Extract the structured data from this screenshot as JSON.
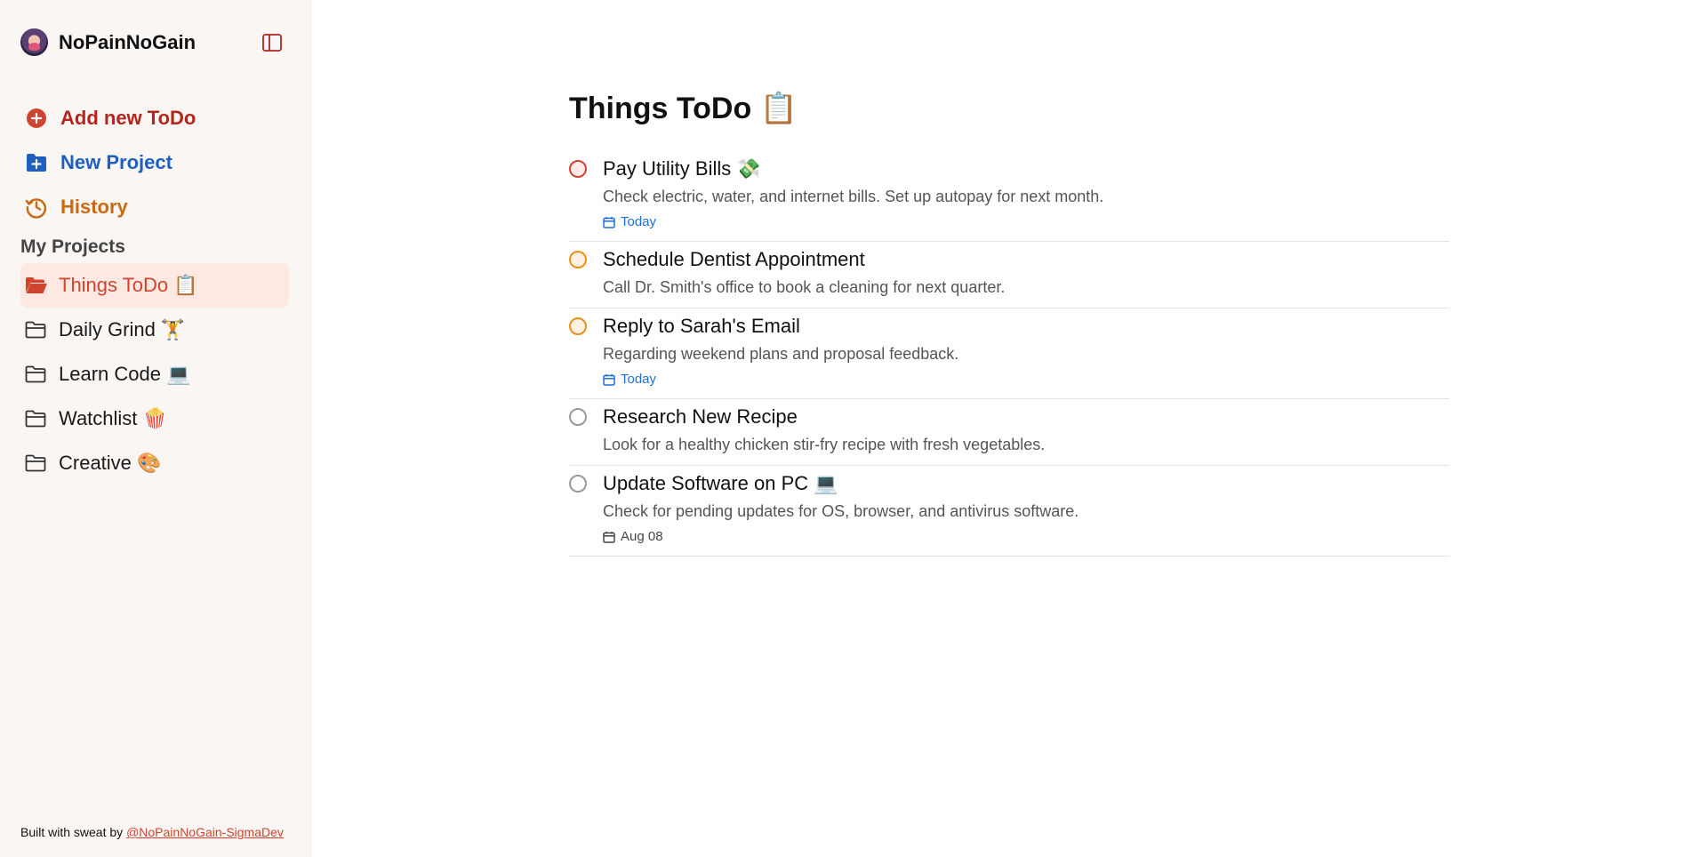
{
  "sidebar": {
    "brand": "NoPainNoGain",
    "actions": {
      "add_todo": "Add new ToDo",
      "new_project": "New Project",
      "history": "History"
    },
    "projects_title": "My Projects",
    "projects": [
      {
        "label": "Things ToDo 📋",
        "active": true
      },
      {
        "label": "Daily Grind 🏋️"
      },
      {
        "label": "Learn Code 💻"
      },
      {
        "label": "Watchlist 🍿"
      },
      {
        "label": "Creative 🎨"
      }
    ],
    "footer": {
      "text": "Built with sweat by ",
      "link": "@NoPainNoGain-SigmaDev"
    }
  },
  "main": {
    "title": "Things ToDo 📋",
    "tasks": [
      {
        "title": "Pay Utility Bills 💸",
        "description": "Check electric, water, and internet bills. Set up autopay for next month.",
        "due": "Today",
        "priority": "red"
      },
      {
        "title": "Schedule Dentist Appointment",
        "description": "Call Dr. Smith's office to book a cleaning for next quarter.",
        "due": "",
        "priority": "orange"
      },
      {
        "title": "Reply to Sarah's Email",
        "description": "Regarding weekend plans and proposal feedback.",
        "due": "Today",
        "priority": "orange"
      },
      {
        "title": "Research New Recipe",
        "description": "Look for a healthy chicken stir-fry recipe with fresh vegetables.",
        "due": "",
        "priority": "gray"
      },
      {
        "title": "Update Software on PC 💻",
        "description": "Check for pending updates for OS, browser, and antivirus software.",
        "due": "Aug 08",
        "priority": "gray"
      }
    ]
  },
  "colors": {
    "accent_red": "#d0442f",
    "project_blue": "#1f5fbf",
    "history_orange": "#c86a12",
    "today_blue": "#1f6fd6"
  }
}
